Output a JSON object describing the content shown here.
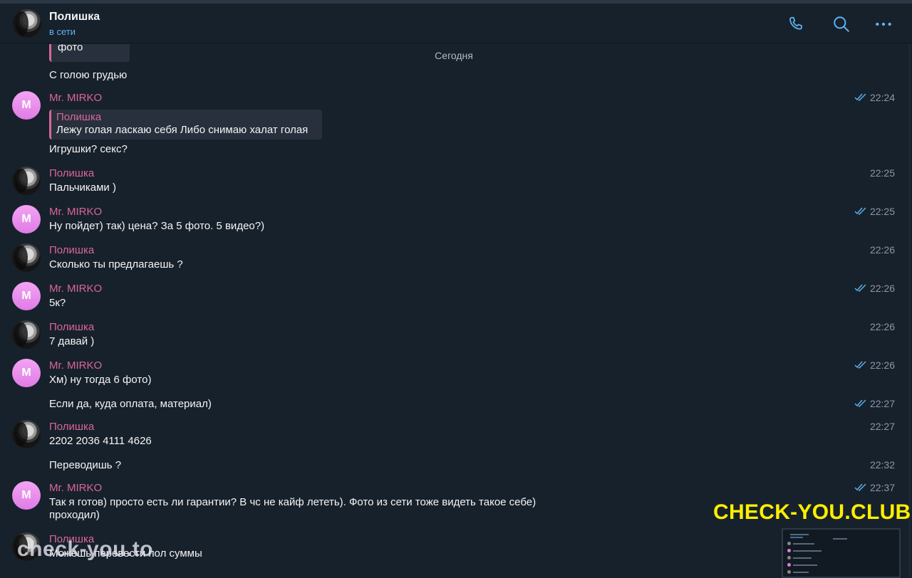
{
  "header": {
    "title": "Полишка",
    "status": "в сети"
  },
  "colors": {
    "background": "#17212b",
    "sender_name": "#d9669b",
    "status_blue": "#5eb5f7",
    "time": "#8a97a5",
    "watermark_yellow": "#ffef00"
  },
  "chat": {
    "top_quote_text": "фото",
    "date_separator": "Сегодня",
    "m0": {
      "text": "С голою грудью"
    },
    "m1": {
      "sender": "Mr. MIRKO",
      "avatar_letter": "M",
      "time": "22:24",
      "quote_name": "Полишка",
      "quote_text": "Лежу голая ласкаю себя  Либо снимаю халат голая",
      "text": "Игрушки? секс?"
    },
    "m2": {
      "sender": "Полишка",
      "time": "22:25",
      "text": "Пальчиками )"
    },
    "m3": {
      "sender": "Mr. MIRKO",
      "avatar_letter": "M",
      "time": "22:25",
      "text": "Ну пойдет) так) цена? За 5 фото. 5 видео?)"
    },
    "m4": {
      "sender": "Полишка",
      "time": "22:26",
      "text": "Сколько ты предлагаешь ?"
    },
    "m5": {
      "sender": "Mr. MIRKO",
      "avatar_letter": "M",
      "time": "22:26",
      "text": "5к?"
    },
    "m6": {
      "sender": "Полишка",
      "time": "22:26",
      "text": "7 давай )"
    },
    "m7": {
      "sender": "Mr. MIRKO",
      "avatar_letter": "M",
      "time": "22:26",
      "text": "Хм) ну тогда 6 фото)"
    },
    "m8": {
      "time": "22:27",
      "text": "Если да, куда оплата, материал)"
    },
    "m9": {
      "sender": "Полишка",
      "time": "22:27",
      "text": "2202 2036 4111 4626"
    },
    "m10": {
      "time": "22:32",
      "text": "Переводишь ?"
    },
    "m11": {
      "sender": "Mr. MIRKO",
      "avatar_letter": "M",
      "time": "22:37",
      "text_line1": "Так я готов) просто есть ли гарантии? В чс не кайф лететь). Фото из сети тоже видеть такое себе)",
      "text_line2": "проходил)"
    },
    "m12": {
      "sender": "Полишка",
      "text": "Можешь перевести пол суммы"
    }
  },
  "watermarks": {
    "left": "check-you.to",
    "right": "CHECK-YOU.CLUB"
  }
}
